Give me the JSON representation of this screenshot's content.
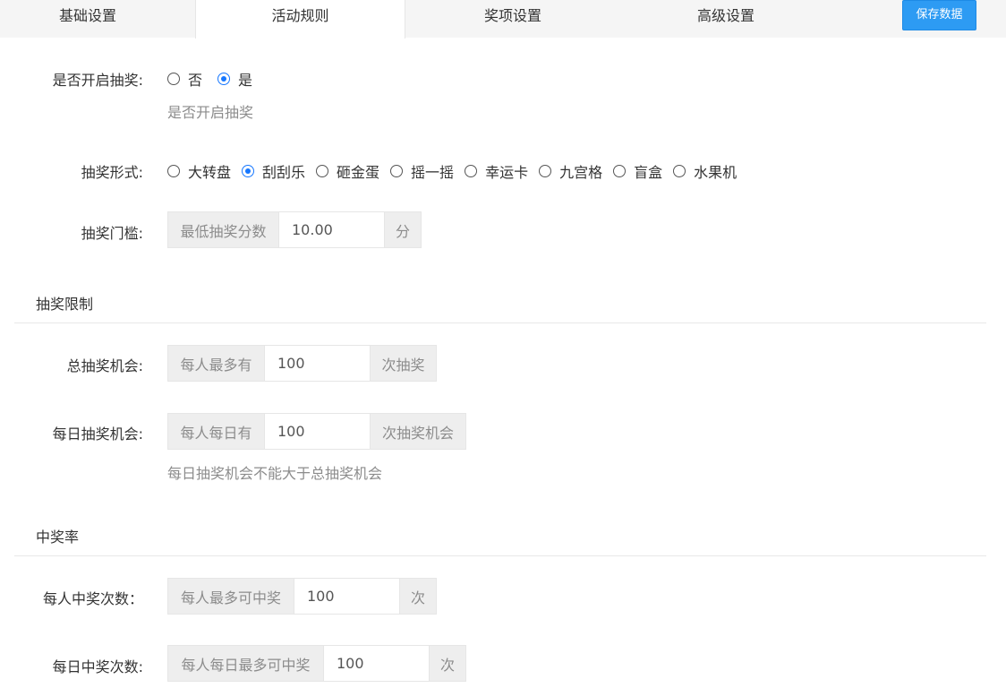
{
  "tabs": [
    "基础设置",
    "活动规则",
    "奖项设置",
    "高级设置"
  ],
  "save_button": "保存数据",
  "enable_lottery": {
    "label": "是否开启抽奖:",
    "options": [
      "否",
      "是"
    ],
    "selected": "是",
    "hint": "是否开启抽奖"
  },
  "lottery_form": {
    "label": "抽奖形式:",
    "options": [
      "大转盘",
      "刮刮乐",
      "砸金蛋",
      "摇一摇",
      "幸运卡",
      "九宫格",
      "盲盒",
      "水果机"
    ],
    "selected": "刮刮乐"
  },
  "threshold": {
    "label": "抽奖门槛:",
    "prefix": "最低抽奖分数",
    "value": "10.00",
    "suffix": "分"
  },
  "limit_section": "抽奖限制",
  "total_chances": {
    "label": "总抽奖机会:",
    "prefix": "每人最多有",
    "value": "100",
    "suffix": "次抽奖"
  },
  "daily_chances": {
    "label": "每日抽奖机会:",
    "prefix": "每人每日有",
    "value": "100",
    "suffix": "次抽奖机会",
    "hint": "每日抽奖机会不能大于总抽奖机会"
  },
  "rate_section": "中奖率",
  "per_person_wins": {
    "label": "每人中奖次数：",
    "prefix": "每人最多可中奖",
    "value": "100",
    "suffix": "次"
  },
  "daily_wins": {
    "label": "每日中奖次数:",
    "prefix": "每人每日最多可中奖",
    "value": "100",
    "suffix": "次"
  },
  "colors": {
    "accent": "#1677ff",
    "save_button": "#2d9bf3",
    "addon_bg": "#eeeeee",
    "tabbar_bg": "#f5f5f5"
  }
}
